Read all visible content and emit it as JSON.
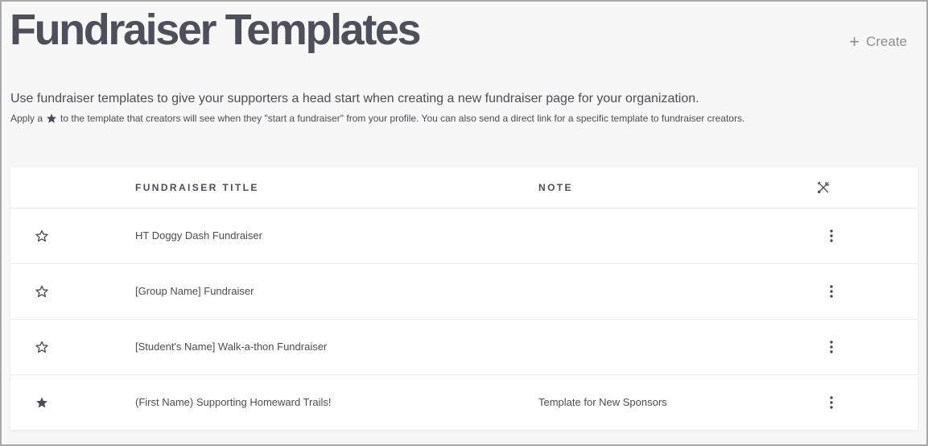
{
  "page": {
    "title": "Fundraiser Templates",
    "create_label": "Create",
    "subtitle": "Use fundraiser templates to give your supporters a head start when creating a new fundraiser page for your organization.",
    "hint_before": "Apply a",
    "hint_after": "to the template that creators will see when they \"start a fundraiser\" from your profile. You can also send a direct link for a specific template to fundraiser creators."
  },
  "table": {
    "headers": {
      "title": "Fundraiser Title",
      "note": "Note",
      "tools_icon": "tools-icon"
    },
    "rows": [
      {
        "starred": false,
        "title": "HT Doggy Dash Fundraiser",
        "note": ""
      },
      {
        "starred": false,
        "title": "[Group Name] Fundraiser",
        "note": ""
      },
      {
        "starred": false,
        "title": "[Student's Name] Walk-a-thon Fundraiser",
        "note": ""
      },
      {
        "starred": true,
        "title": "(First Name) Supporting Homeward Trails!",
        "note": "Template for New Sponsors"
      }
    ]
  },
  "icons": {
    "create": "plus-icon",
    "star_outline": "star-outline-icon",
    "star_filled": "star-filled-icon",
    "row_menu": "vertical-ellipsis-icon"
  },
  "colors": {
    "text": "#4a4d57",
    "muted": "#8a8d96",
    "background": "#f7f7f8",
    "card": "#ffffff"
  }
}
